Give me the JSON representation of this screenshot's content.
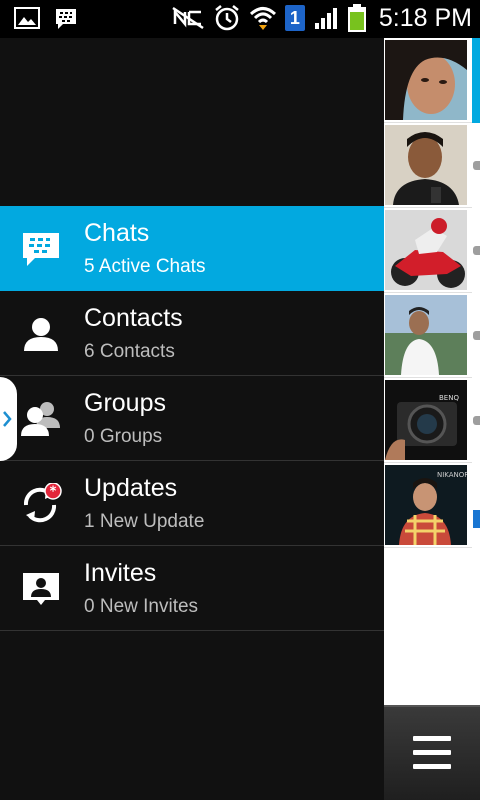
{
  "status_bar": {
    "time": "5:18 PM",
    "notification_badge": "1",
    "left_icons": [
      "image-icon",
      "bbm-chat-icon"
    ],
    "right_icons": [
      "nfc-off-icon",
      "alarm-icon",
      "wifi-icon",
      "sim-badge-icon",
      "signal-icon",
      "battery-icon"
    ]
  },
  "drawer": {
    "items": [
      {
        "title": "Chats",
        "subtitle": "5 Active Chats",
        "icon": "bbm-chat-icon",
        "active": true
      },
      {
        "title": "Contacts",
        "subtitle": "6 Contacts",
        "icon": "contact-icon",
        "active": false
      },
      {
        "title": "Groups",
        "subtitle": "0 Groups",
        "icon": "groups-icon",
        "active": false
      },
      {
        "title": "Updates",
        "subtitle": "1 New Update",
        "icon": "updates-icon",
        "active": false
      },
      {
        "title": "Invites",
        "subtitle": "0 New Invites",
        "icon": "invites-icon",
        "active": false
      }
    ]
  },
  "chat_peek": {
    "avatars": [
      "avatar-woman",
      "avatar-man-phone",
      "avatar-motorcycle",
      "avatar-man-coast",
      "avatar-camera",
      "avatar-man-plaid"
    ]
  },
  "colors": {
    "accent": "#02a9e0",
    "drawer_bg": "#111111",
    "status_bar_bg": "#000000"
  }
}
